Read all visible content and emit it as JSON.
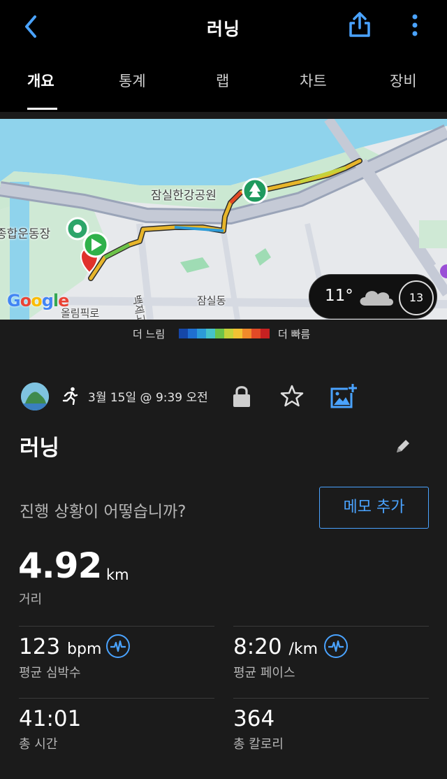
{
  "header": {
    "title": "러닝",
    "back_icon": "chevron-left-icon",
    "share_icon": "share-icon",
    "more_icon": "more-vertical-icon",
    "accent_color": "#4aa3ff"
  },
  "tabs": [
    {
      "label": "개요",
      "active": true
    },
    {
      "label": "통계",
      "active": false
    },
    {
      "label": "랩",
      "active": false
    },
    {
      "label": "차트",
      "active": false
    },
    {
      "label": "장비",
      "active": false
    }
  ],
  "map": {
    "labels": {
      "park": "잠실한강공원",
      "stadium": "종합운동장",
      "road1": "올림픽로",
      "road2": "백제고",
      "district": "잠실동"
    },
    "google": "Google",
    "weather": {
      "temperature": "11°",
      "wind": "13",
      "icon": "cloud-icon"
    }
  },
  "pace_scale": {
    "slow_label": "더 느림",
    "fast_label": "더 빠름",
    "colors": [
      "#1547a8",
      "#1f6fd0",
      "#2c9bd8",
      "#46c3c9",
      "#6cc34a",
      "#c6d23a",
      "#f2c233",
      "#f18a2a",
      "#e24a26",
      "#c62121"
    ]
  },
  "activity": {
    "date": "3월 15일 @ 9:39 오전",
    "name": "러닝",
    "prompt": "진행 상황이 어떻습니까?",
    "memo_button": "메모 추가"
  },
  "summary": {
    "distance": {
      "value": "4.92",
      "unit": "km",
      "label": "거리"
    },
    "heart_rate": {
      "value": "123",
      "unit": "bpm",
      "label": "평균 심박수"
    },
    "pace": {
      "value": "8:20",
      "unit": "/km",
      "label": "평균 페이스"
    },
    "time": {
      "value": "41:01",
      "label": "총 시간"
    },
    "calories": {
      "value": "364",
      "label": "총 칼로리"
    }
  }
}
